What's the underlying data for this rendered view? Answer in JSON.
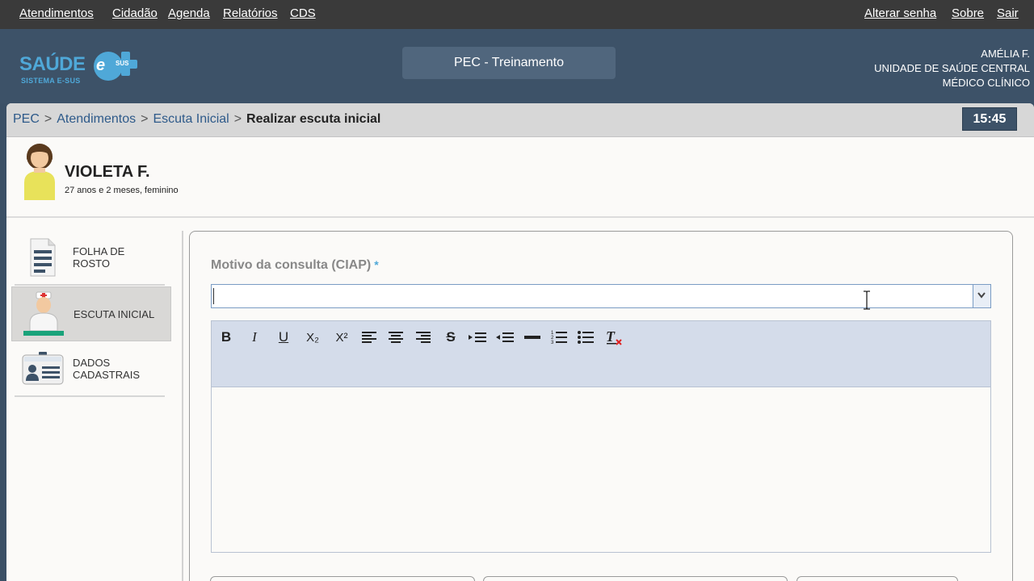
{
  "topnav": {
    "left_items": [
      "Atendimentos",
      "Cidadão",
      "Agenda",
      "Relatórios",
      "CDS"
    ],
    "right_items": [
      "Alterar senha",
      "Sobre",
      "Sair"
    ]
  },
  "header": {
    "logo_text": "SAÚDE",
    "logo_esus": "e",
    "logo_sus": "SUS",
    "logo_sub": "SISTEMA E-SUS",
    "environment": "PEC - Treinamento",
    "user": {
      "name": "Amélia F.",
      "unit": "Unidade de Saúde Central",
      "role": "Médico Clínico"
    }
  },
  "breadcrumb": {
    "items": [
      "PEC",
      "Atendimentos",
      "Escuta Inicial"
    ],
    "separator": ">",
    "current": "Realizar escuta inicial"
  },
  "clock": "15:45",
  "patient": {
    "name": "VIOLETA F.",
    "details": "27 anos e 2 meses, feminino"
  },
  "sidebar": {
    "items": [
      {
        "label": "Folha de rosto",
        "icon": "document-icon"
      },
      {
        "label": "Escuta inicial",
        "icon": "nurse-icon"
      },
      {
        "label": "Dados cadastrais",
        "icon": "id-card-icon"
      }
    ]
  },
  "form": {
    "field_label": "Motivo da consulta (CIAP)",
    "required_mark": "*",
    "combo_value": "",
    "toolbar": [
      {
        "label": "B",
        "name": "bold-button"
      },
      {
        "label": "I",
        "name": "italic-button"
      },
      {
        "label": "U",
        "name": "underline-button"
      },
      {
        "label": "X₂",
        "name": "subscript-button"
      },
      {
        "label": "X²",
        "name": "superscript-button"
      },
      {
        "label": "align-left",
        "name": "align-left-button"
      },
      {
        "label": "align-center",
        "name": "align-center-button"
      },
      {
        "label": "align-right",
        "name": "align-right-button"
      },
      {
        "label": "S",
        "name": "strikethrough-button"
      },
      {
        "label": "indent",
        "name": "indent-button"
      },
      {
        "label": "outdent",
        "name": "outdent-button"
      },
      {
        "label": "hr",
        "name": "horizontal-rule-button"
      },
      {
        "label": "ordered-list",
        "name": "ordered-list-button"
      },
      {
        "label": "unordered-list",
        "name": "unordered-list-button"
      },
      {
        "label": "clear-format",
        "name": "clear-format-button"
      }
    ]
  },
  "colors": {
    "topnav_bg": "#3a3a3a",
    "header_bg": "#3d5268",
    "brand_blue": "#4fa8d8",
    "link_blue": "#2e5a8a",
    "toolbar_bg": "#d4dcea"
  }
}
